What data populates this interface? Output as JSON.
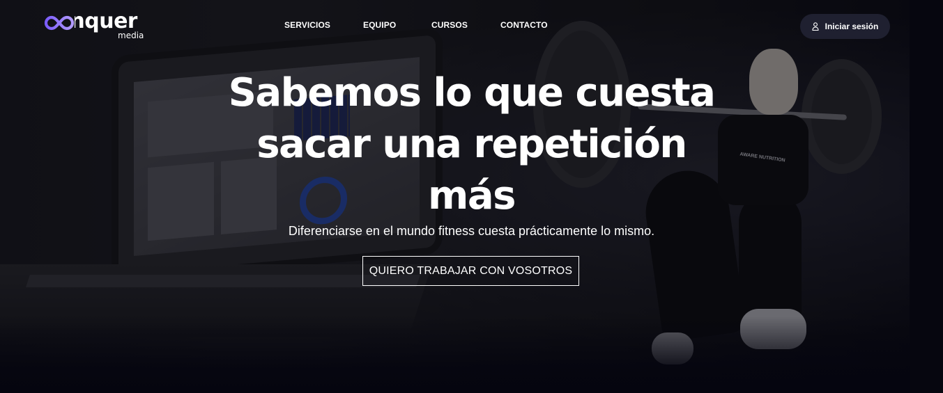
{
  "brand": {
    "logo_text": "conquer",
    "logo_sub": "media",
    "colors": {
      "logo_gradient_start": "#7b5cff",
      "logo_gradient_end": "#b39cff",
      "button_bg": "#1f2030",
      "page_bg": "#05050f"
    }
  },
  "nav": {
    "items": [
      {
        "label": "SERVICIOS"
      },
      {
        "label": "EQUIPO"
      },
      {
        "label": "CURSOS"
      },
      {
        "label": "CONTACTO"
      }
    ]
  },
  "login": {
    "label": "Iniciar sesión",
    "icon": "user-icon"
  },
  "hero": {
    "headline_lines": [
      "Sabemos lo que cuesta",
      "sacar una repetición",
      "más"
    ],
    "subline": "Diferenciarse en el mundo fitness cuesta prácticamente lo mismo.",
    "cta_label": "QUIERO TRABAJAR CON VOSOTROS",
    "shirt_print": "AWARE NUTRITION"
  }
}
